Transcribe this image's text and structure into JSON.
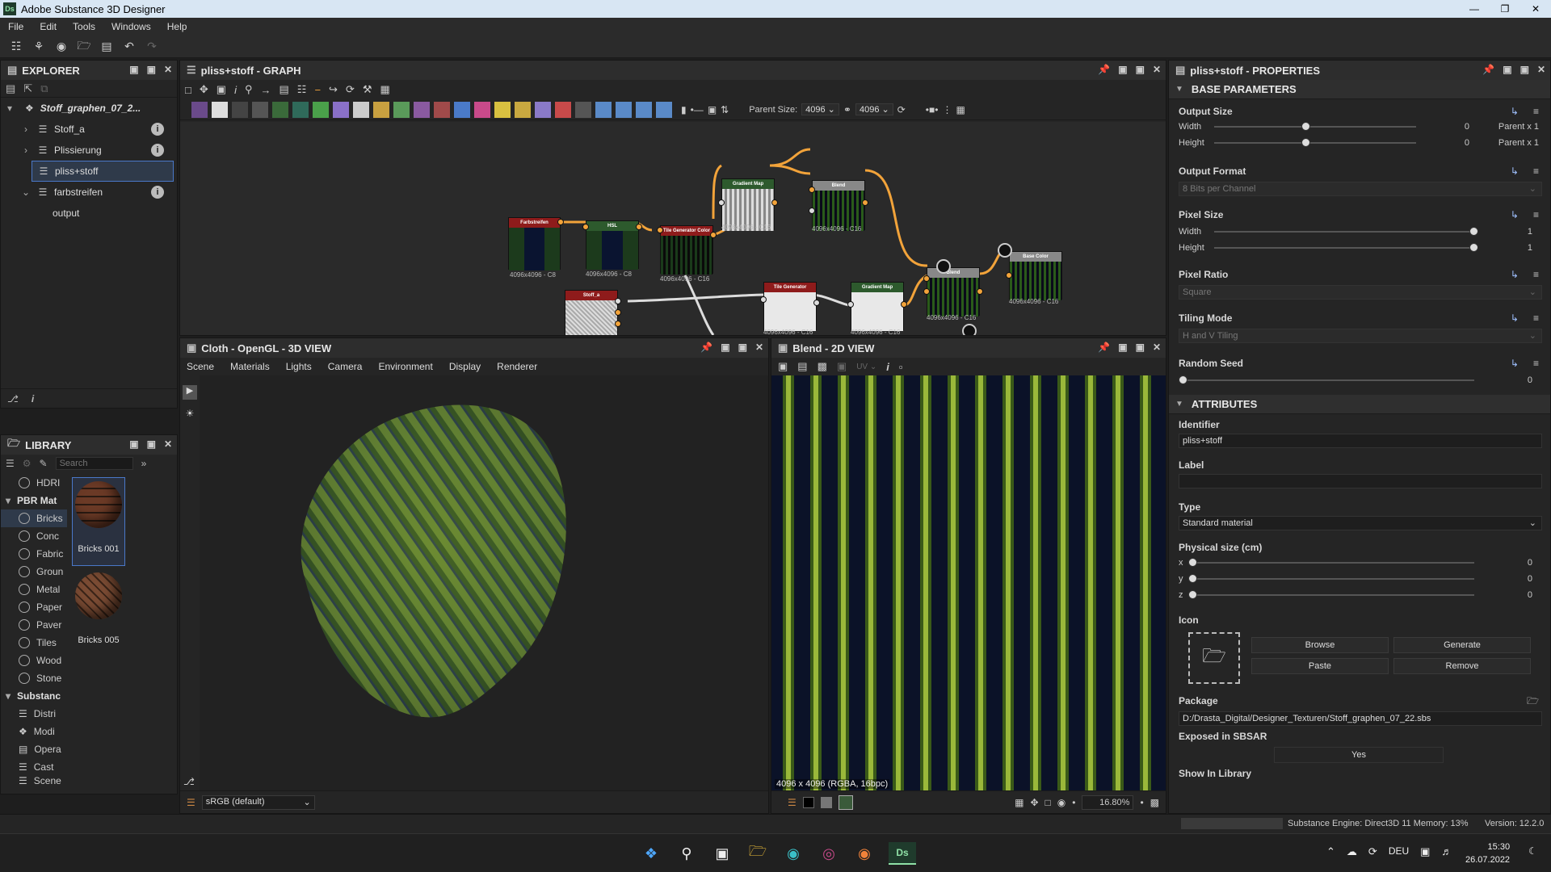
{
  "app": {
    "title": "Adobe Substance 3D Designer",
    "logo": "Ds"
  },
  "menu": [
    "File",
    "Edit",
    "Tools",
    "Windows",
    "Help"
  ],
  "explorer": {
    "title": "EXPLORER",
    "package": "Stoff_graphen_07_2...",
    "items": [
      {
        "label": "Stoff_a",
        "expanded": false,
        "info": true
      },
      {
        "label": "Plissierung",
        "expanded": false,
        "info": true
      },
      {
        "label": "pliss+stoff",
        "expanded": false,
        "selected": true
      },
      {
        "label": "farbstreifen",
        "expanded": true,
        "info": true
      },
      {
        "label": "output",
        "child": true
      }
    ]
  },
  "library": {
    "title": "LIBRARY",
    "search_placeholder": "Search",
    "categories": [
      {
        "label": "HDRI",
        "type": "item"
      },
      {
        "label": "PBR Mat",
        "type": "header"
      },
      {
        "label": "Bricks",
        "type": "item",
        "selected": true
      },
      {
        "label": "Conc",
        "type": "item"
      },
      {
        "label": "Fabric",
        "type": "item"
      },
      {
        "label": "Groun",
        "type": "item"
      },
      {
        "label": "Metal",
        "type": "item"
      },
      {
        "label": "Paper",
        "type": "item"
      },
      {
        "label": "Paver",
        "type": "item"
      },
      {
        "label": "Tiles",
        "type": "item"
      },
      {
        "label": "Wood",
        "type": "item"
      },
      {
        "label": "Stone",
        "type": "item"
      },
      {
        "label": "Substanc",
        "type": "header"
      },
      {
        "label": "Distri",
        "type": "item"
      },
      {
        "label": "Modi",
        "type": "item"
      },
      {
        "label": "Opera",
        "type": "item"
      },
      {
        "label": "Cast",
        "type": "item"
      },
      {
        "label": "Scene",
        "type": "item"
      }
    ],
    "thumbs": [
      {
        "label": "Bricks 001"
      },
      {
        "label": "Bricks 005"
      }
    ]
  },
  "graph": {
    "title": "pliss+stoff - GRAPH",
    "parent_size_label": "Parent Size:",
    "parent_size_value": "4096",
    "parent_size_value2": "4096",
    "nodes": [
      {
        "title": "Farbstreifen",
        "size": "4096x4096 - C8"
      },
      {
        "title": "HSL",
        "size": "4096x4096 - C8"
      },
      {
        "title": "Tile Generator Color",
        "size": "4096x4096 - C16"
      },
      {
        "title": "Gradient Map",
        "size": "4096x4096 - C16"
      },
      {
        "title": "Blend",
        "size": "4096x4096 - C16"
      },
      {
        "title": "Blend",
        "size": "4096x4096 - C16"
      },
      {
        "title": "Base Color",
        "size": "4096x4096 - C16"
      },
      {
        "title": "Stoff_a",
        "size": ""
      },
      {
        "title": "Tile Generator",
        "size": "4096x4096 - C16"
      },
      {
        "title": "Gradient Map",
        "size": "4096x4096 - C16"
      }
    ]
  },
  "view3d": {
    "title": "Cloth - OpenGL - 3D VIEW",
    "menu": [
      "Scene",
      "Materials",
      "Lights",
      "Camera",
      "Environment",
      "Display",
      "Renderer"
    ],
    "colorspace": "sRGB (default)"
  },
  "view2d": {
    "title": "Blend - 2D VIEW",
    "uv_label": "UV",
    "info": "4096 x 4096 (RGBA, 16bpc)",
    "zoom": "16.80%"
  },
  "properties": {
    "title": "pliss+stoff - PROPERTIES",
    "base_section": "BASE PARAMETERS",
    "output_size": {
      "label": "Output Size",
      "width_label": "Width",
      "height_label": "Height",
      "width_value": "0",
      "height_value": "0",
      "width_parent": "Parent x 1",
      "height_parent": "Parent x 1",
      "slider_pos": 0.44
    },
    "output_format": {
      "label": "Output Format",
      "value": "8 Bits per Channel"
    },
    "pixel_size": {
      "label": "Pixel Size",
      "width_label": "Width",
      "height_label": "Height",
      "width_value": "1",
      "height_value": "1"
    },
    "pixel_ratio": {
      "label": "Pixel Ratio",
      "value": "Square"
    },
    "tiling_mode": {
      "label": "Tiling Mode",
      "value": "H and V Tiling"
    },
    "random_seed": {
      "label": "Random Seed",
      "value": "0"
    },
    "attributes_section": "ATTRIBUTES",
    "identifier": {
      "label": "Identifier",
      "value": "pliss+stoff"
    },
    "label_field": {
      "label": "Label",
      "value": ""
    },
    "type": {
      "label": "Type",
      "value": "Standard material"
    },
    "physical_size": {
      "label": "Physical size (cm)",
      "x": "0",
      "y": "0",
      "z": "0",
      "x_label": "x",
      "y_label": "y",
      "z_label": "z"
    },
    "icon": {
      "label": "Icon",
      "browse": "Browse",
      "generate": "Generate",
      "paste": "Paste",
      "remove": "Remove"
    },
    "package": {
      "label": "Package",
      "value": "D:/Drasta_Digital/Designer_Texturen/Stoff_graphen_07_22.sbs"
    },
    "exposed": {
      "label": "Exposed in SBSAR",
      "value": "Yes"
    },
    "show_in_library": {
      "label": "Show In Library"
    }
  },
  "status": {
    "engine": "Substance Engine: Direct3D 11  Memory: 13%",
    "version": "Version: 12.2.0"
  },
  "taskbar": {
    "lang": "DEU",
    "time": "15:30",
    "date": "26.07.2022"
  },
  "colors": {
    "accent": "#f2a33a",
    "selection": "#4a78c8",
    "node_red": "#8e1b1b",
    "node_green": "#2d5a2d"
  }
}
